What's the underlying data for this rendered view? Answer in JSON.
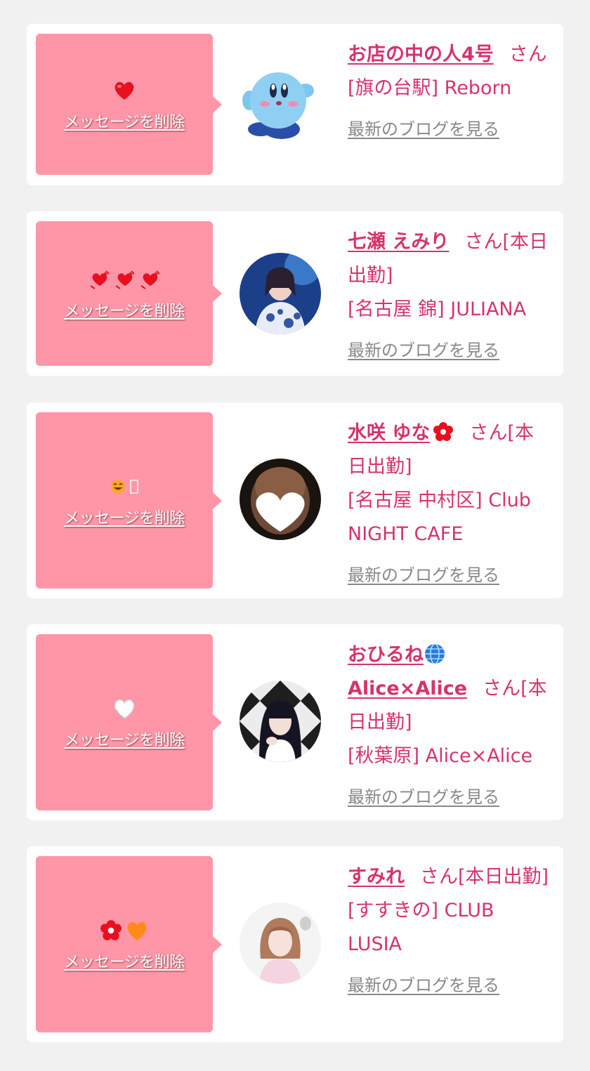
{
  "colors": {
    "page_bg": "#f1f1f1",
    "card_bg": "#ffffff",
    "bubble_bg": "#ff96a8",
    "accent_text": "#d6336c",
    "blog_link": "#888888"
  },
  "delete_label": "メッセージを削除",
  "blog_label": "最新のブログを見る",
  "cards": [
    {
      "name": "お店の中の人4号",
      "suffix": "さん",
      "shop": "[旗の台駅] Reborn",
      "reaction_icons": [
        "red-heart-icon"
      ]
    },
    {
      "name": "七瀬 えみり",
      "suffix": "さん[本日出勤]",
      "shop": "[名古屋 錦] JULIANA",
      "reaction_icons": [
        "sparkling-heart-icon",
        "sparkling-heart-icon",
        "sparkling-heart-icon"
      ]
    },
    {
      "name": "水咲 ゆな",
      "name_icon": "red-flower-icon",
      "suffix": "さん[本日出勤]",
      "shop": "[名古屋 中村区] Club NIGHT CAFE",
      "reaction_icons": [
        "smiling-face-icon",
        "missing-glyph-icon"
      ]
    },
    {
      "name": "おひるね",
      "name_icon": "globe-icon",
      "name_line2": "Alice×Alice",
      "suffix": "さん[本日出勤]",
      "shop": "[秋葉原] Alice×Alice",
      "reaction_icons": [
        "white-heart-icon"
      ]
    },
    {
      "name": "すみれ",
      "suffix": "さん[本日出勤]",
      "shop": "[すすきの] CLUB LUSIA",
      "reaction_icons": [
        "red-flower-icon",
        "orange-heart-icon"
      ]
    }
  ]
}
